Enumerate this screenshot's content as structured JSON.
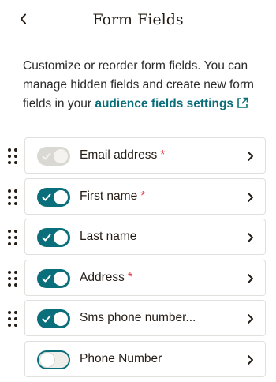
{
  "header": {
    "title": "Form Fields",
    "back_icon": "chevron-left-icon"
  },
  "description": {
    "text": "Customize or reorder form fields. You can manage hidden fields and create new form fields in your ",
    "link_label": "audience fields settings",
    "link_icon": "external-link-icon"
  },
  "colors": {
    "accent": "#0a6f7a",
    "required": "#e0333a",
    "text": "#241c15"
  },
  "fields": [
    {
      "label": "Email address",
      "required": "*",
      "state": "on-disabled"
    },
    {
      "label": "First name",
      "required": "*",
      "state": "on"
    },
    {
      "label": "Last name",
      "required": "",
      "state": "on"
    },
    {
      "label": "Address",
      "required": "*",
      "state": "on"
    },
    {
      "label": "Sms phone number...",
      "required": "",
      "state": "on"
    },
    {
      "label": "Phone Number",
      "required": "",
      "state": "off"
    }
  ]
}
